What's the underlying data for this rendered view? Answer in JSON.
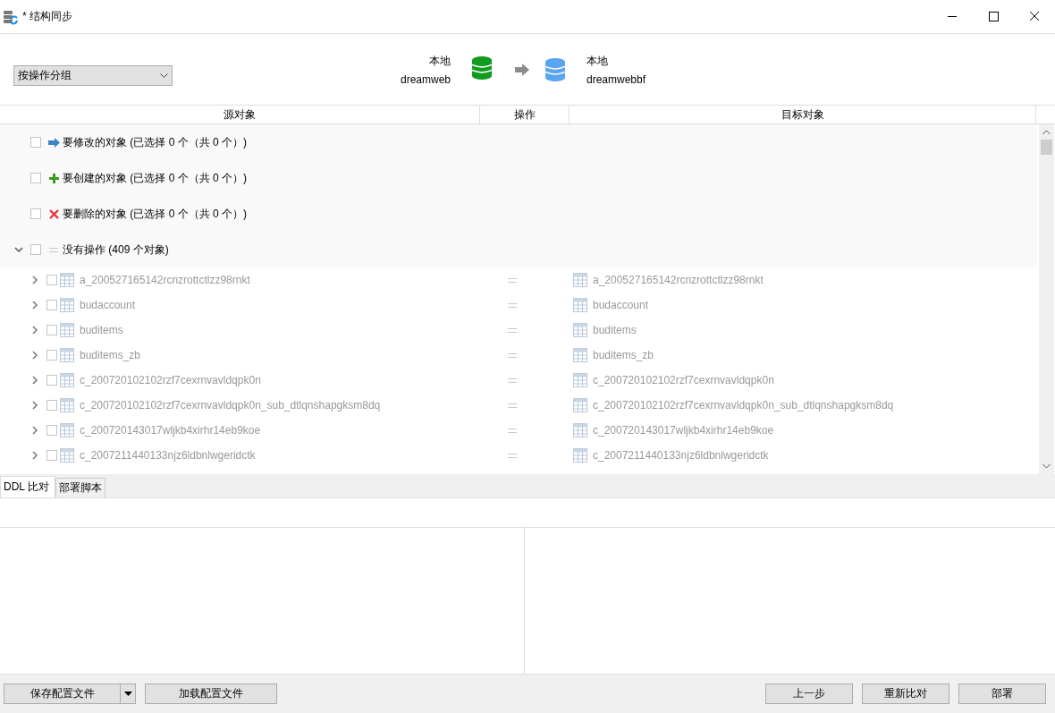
{
  "window": {
    "title": "* 结构同步"
  },
  "group_by": {
    "value": "按操作分组"
  },
  "source": {
    "location": "本地",
    "database": "dreamweb"
  },
  "target": {
    "location": "本地",
    "database": "dreamwebbf"
  },
  "columns": [
    "源对象",
    "操作",
    "目标对象"
  ],
  "groups": [
    {
      "kind": "modify",
      "label": "要修改的对象 (已选择 0 个（共 0 个）)",
      "checked": false
    },
    {
      "kind": "create",
      "label": "要创建的对象 (已选择 0 个（共 0 个）)",
      "checked": false
    },
    {
      "kind": "delete",
      "label": "要删除的对象 (已选择 0 个（共 0 个）)",
      "checked": false
    }
  ],
  "no_action_group": {
    "label": "没有操作 (409 个对象)",
    "checked": false,
    "expanded": true,
    "items": [
      {
        "source": "a_200527165142rcnzrottctlzz98rnkt",
        "target": "a_200527165142rcnzrottctlzz98rnkt",
        "checked": false
      },
      {
        "source": "budaccount",
        "target": "budaccount",
        "checked": false
      },
      {
        "source": "buditems",
        "target": "buditems",
        "checked": false
      },
      {
        "source": "buditems_zb",
        "target": "buditems_zb",
        "checked": false
      },
      {
        "source": "c_200720102102rzf7cexrnvavldqpk0n",
        "target": "c_200720102102rzf7cexrnvavldqpk0n",
        "checked": false
      },
      {
        "source": "c_200720102102rzf7cexrnvavldqpk0n_sub_dtlqnshapgksm8dq",
        "target": "c_200720102102rzf7cexrnvavldqpk0n_sub_dtlqnshapgksm8dq",
        "checked": false
      },
      {
        "source": "c_200720143017wljkb4xirhr14eb9koe",
        "target": "c_200720143017wljkb4xirhr14eb9koe",
        "checked": false
      },
      {
        "source": "c_2007211440133njz6ldbnlwgeridctk",
        "target": "c_2007211440133njz6ldbnlwgeridctk",
        "checked": false
      }
    ]
  },
  "tabs": [
    {
      "label": "DDL 比对",
      "selected": true
    },
    {
      "label": "部署脚本",
      "selected": false
    }
  ],
  "footer_left": [
    {
      "kind": "split",
      "label": "保存配置文件"
    },
    {
      "kind": "plain",
      "label": "加载配置文件"
    }
  ],
  "footer_right": [
    {
      "kind": "plain",
      "label": "上一步"
    },
    {
      "kind": "plain",
      "label": "重新比对"
    },
    {
      "kind": "plain",
      "label": "部署"
    }
  ]
}
